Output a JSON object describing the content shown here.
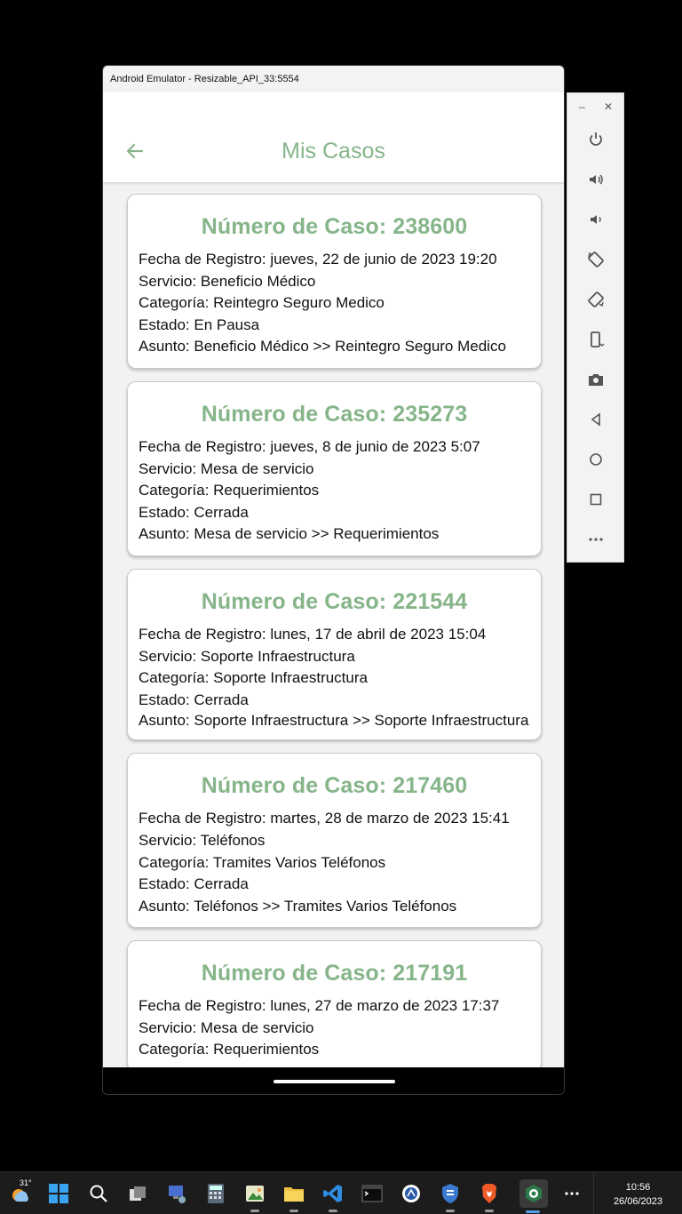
{
  "window": {
    "title": "Android Emulator - Resizable_API_33:5554"
  },
  "app": {
    "title": "Mis Casos",
    "accent_color": "#86b58a"
  },
  "cases": [
    {
      "title": "Número de Caso: 238600",
      "fecha": "Fecha de Registro: jueves, 22 de junio de 2023 19:20",
      "servicio": "Servicio: Beneficio Médico",
      "categoria": "Categoría: Reintegro Seguro Medico",
      "estado": "Estado: En Pausa",
      "asunto": "Asunto: Beneficio Médico >> Reintegro Seguro Medico"
    },
    {
      "title": "Número de Caso: 235273",
      "fecha": "Fecha de Registro: jueves, 8 de junio de 2023 5:07",
      "servicio": "Servicio: Mesa de servicio",
      "categoria": "Categoría: Requerimientos",
      "estado": "Estado: Cerrada",
      "asunto": "Asunto: Mesa de servicio >> Requerimientos"
    },
    {
      "title": "Número de Caso: 221544",
      "fecha": "Fecha de Registro: lunes, 17 de abril de 2023 15:04",
      "servicio": "Servicio: Soporte Infraestructura",
      "categoria": "Categoría: Soporte Infraestructura",
      "estado": "Estado: Cerrada",
      "asunto": "Asunto: Soporte Infraestructura >> Soporte Infraestructura"
    },
    {
      "title": "Número de Caso: 217460",
      "fecha": "Fecha de Registro: martes, 28 de marzo de 2023 15:41",
      "servicio": "Servicio: Teléfonos",
      "categoria": "Categoría: Tramites Varios Teléfonos",
      "estado": "Estado: Cerrada",
      "asunto": "Asunto: Teléfonos >> Tramites Varios Teléfonos"
    },
    {
      "title": "Número de Caso: 217191",
      "fecha": "Fecha de Registro: lunes, 27 de marzo de 2023 17:37",
      "servicio": "Servicio: Mesa de servicio",
      "categoria": "Categoría: Requerimientos",
      "estado": "",
      "asunto": ""
    }
  ],
  "taskbar": {
    "weather_temp": "31°",
    "time": "10:56",
    "date": "26/06/2023"
  }
}
